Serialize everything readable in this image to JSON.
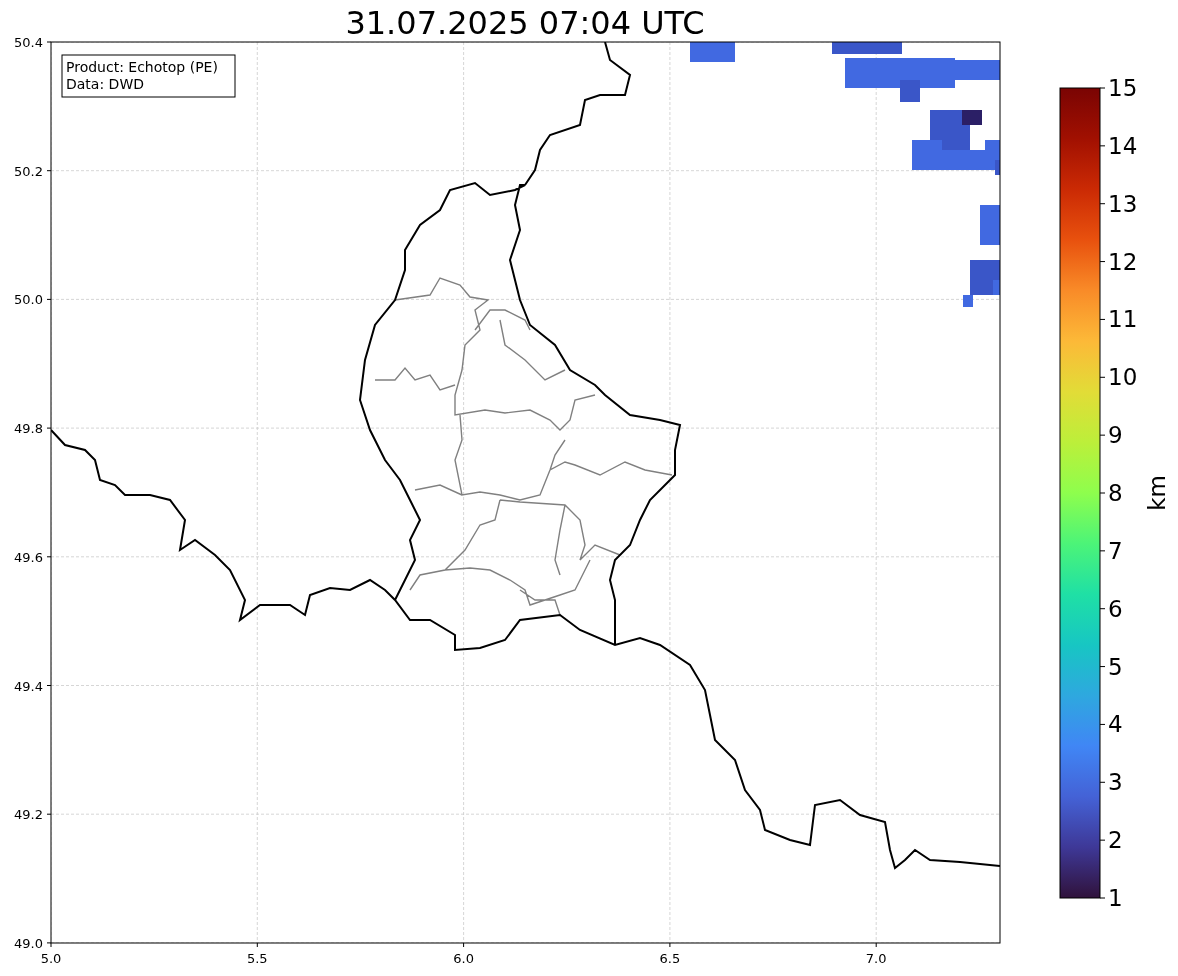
{
  "title": "31.07.2025 07:04 UTC",
  "info_box": [
    "Product: Echotop (PE)",
    "Data: DWD"
  ],
  "map": {
    "xticks": [
      "5.0",
      "5.5",
      "6.0",
      "6.5",
      "7.0"
    ],
    "yticks": [
      "50.4",
      "50.2",
      "50.0",
      "49.8",
      "49.6",
      "49.4",
      "49.2",
      "49.0"
    ]
  },
  "colorbar": {
    "label": "km",
    "ticks": [
      "15",
      "14",
      "13",
      "12",
      "11",
      "10",
      "9",
      "8",
      "7",
      "6",
      "5",
      "4",
      "3",
      "2",
      "1"
    ]
  }
}
